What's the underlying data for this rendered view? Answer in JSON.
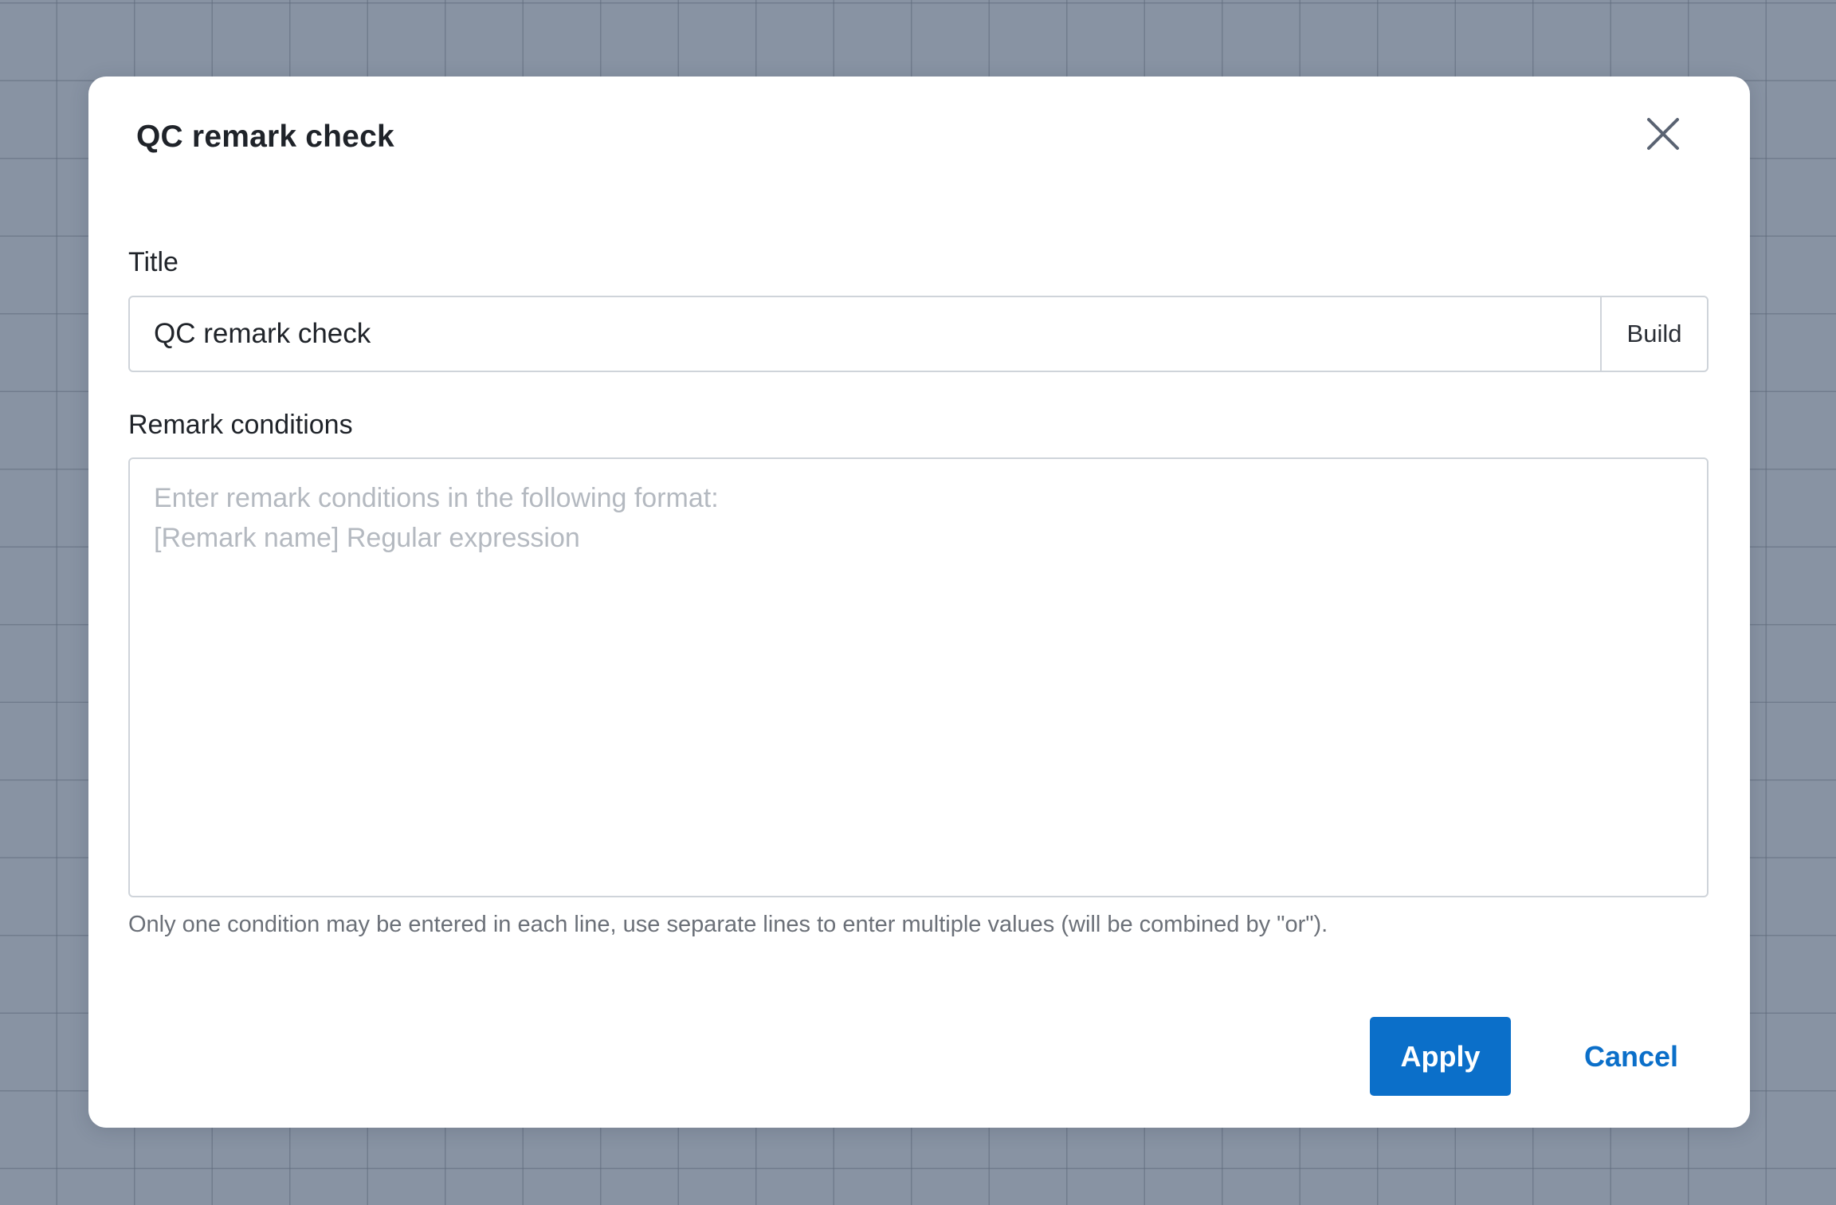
{
  "modal": {
    "title": "QC remark check",
    "close_icon": "close-icon"
  },
  "title_field": {
    "label": "Title",
    "value": "QC remark check",
    "build_label": "Build"
  },
  "remark_field": {
    "label": "Remark conditions",
    "value": "",
    "placeholder": "Enter remark conditions in the following format:\n[Remark name] Regular expression",
    "hint": "Only one condition may be entered in each line, use separate lines to enter multiple values (will be combined by \"or\")."
  },
  "footer": {
    "apply_label": "Apply",
    "cancel_label": "Cancel"
  },
  "colors": {
    "accent": "#0b6fc9",
    "backdrop": "#8893a3",
    "placeholder": "#b4b9c0",
    "border": "#cfd4da"
  }
}
